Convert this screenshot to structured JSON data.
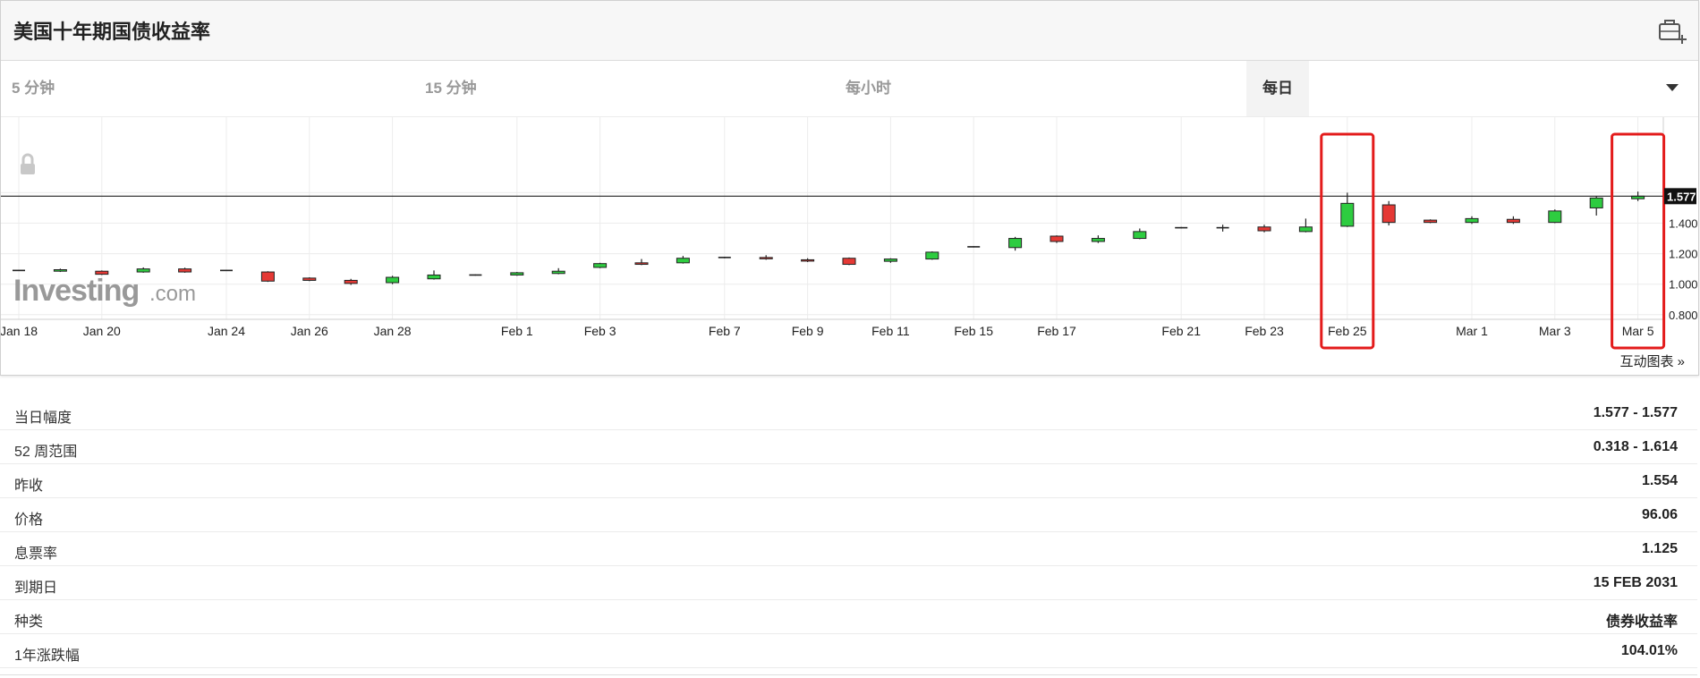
{
  "header": {
    "title": "美国十年期国债收益率",
    "portfolio_icon": "briefcase-plus-icon"
  },
  "tabs": [
    {
      "label": "5 分钟",
      "active": false
    },
    {
      "label": "15 分钟",
      "active": false
    },
    {
      "label": "每小时",
      "active": false
    },
    {
      "label": "每日",
      "active": true
    }
  ],
  "chart": {
    "interactive_link": "互动图表 »",
    "watermark": "Investing",
    "watermark_suffix": ".com"
  },
  "chart_data": {
    "type": "candlestick",
    "title": "",
    "y_ticks": [
      "1.400",
      "1.200",
      "1.000",
      "0.800"
    ],
    "ylim": [
      0.8,
      1.65
    ],
    "current_value": 1.577,
    "current_label": "1.577",
    "grid": true,
    "x_tick_labels": [
      {
        "i": 0,
        "label": "Jan 18"
      },
      {
        "i": 2,
        "label": "Jan 20"
      },
      {
        "i": 5,
        "label": "Jan 24"
      },
      {
        "i": 7,
        "label": "Jan 26"
      },
      {
        "i": 9,
        "label": "Jan 28"
      },
      {
        "i": 12,
        "label": "Feb 1"
      },
      {
        "i": 14,
        "label": "Feb 3"
      },
      {
        "i": 17,
        "label": "Feb 7"
      },
      {
        "i": 19,
        "label": "Feb 9"
      },
      {
        "i": 21,
        "label": "Feb 11"
      },
      {
        "i": 23,
        "label": "Feb 15"
      },
      {
        "i": 25,
        "label": "Feb 17"
      },
      {
        "i": 28,
        "label": "Feb 21"
      },
      {
        "i": 30,
        "label": "Feb 23"
      },
      {
        "i": 32,
        "label": "Feb 25"
      },
      {
        "i": 35,
        "label": "Mar 1"
      },
      {
        "i": 37,
        "label": "Mar 3"
      },
      {
        "i": 39,
        "label": "Mar 5"
      }
    ],
    "highlighted": [
      32,
      39
    ],
    "candles": [
      {
        "o": 1.09,
        "c": 1.09,
        "h": 1.094,
        "l": 1.086
      },
      {
        "o": 1.085,
        "c": 1.095,
        "h": 1.102,
        "l": 1.08
      },
      {
        "o": 1.085,
        "c": 1.065,
        "h": 1.09,
        "l": 1.06
      },
      {
        "o": 1.08,
        "c": 1.1,
        "h": 1.11,
        "l": 1.075
      },
      {
        "o": 1.1,
        "c": 1.08,
        "h": 1.108,
        "l": 1.075
      },
      {
        "o": 1.09,
        "c": 1.09,
        "h": 1.094,
        "l": 1.086
      },
      {
        "o": 1.08,
        "c": 1.02,
        "h": 1.085,
        "l": 1.015
      },
      {
        "o": 1.04,
        "c": 1.025,
        "h": 1.045,
        "l": 1.02
      },
      {
        "o": 1.025,
        "c": 1.005,
        "h": 1.035,
        "l": 0.995
      },
      {
        "o": 1.01,
        "c": 1.045,
        "h": 1.055,
        "l": 1.0
      },
      {
        "o": 1.035,
        "c": 1.06,
        "h": 1.09,
        "l": 1.03
      },
      {
        "o": 1.06,
        "c": 1.06,
        "h": 1.064,
        "l": 1.056
      },
      {
        "o": 1.06,
        "c": 1.075,
        "h": 1.08,
        "l": 1.055
      },
      {
        "o": 1.07,
        "c": 1.085,
        "h": 1.105,
        "l": 1.065
      },
      {
        "o": 1.11,
        "c": 1.135,
        "h": 1.14,
        "l": 1.105
      },
      {
        "o": 1.14,
        "c": 1.13,
        "h": 1.165,
        "l": 1.125
      },
      {
        "o": 1.14,
        "c": 1.17,
        "h": 1.185,
        "l": 1.135
      },
      {
        "o": 1.175,
        "c": 1.175,
        "h": 1.18,
        "l": 1.17
      },
      {
        "o": 1.175,
        "c": 1.17,
        "h": 1.19,
        "l": 1.16
      },
      {
        "o": 1.16,
        "c": 1.155,
        "h": 1.17,
        "l": 1.145
      },
      {
        "o": 1.17,
        "c": 1.13,
        "h": 1.175,
        "l": 1.125
      },
      {
        "o": 1.15,
        "c": 1.165,
        "h": 1.17,
        "l": 1.14
      },
      {
        "o": 1.165,
        "c": 1.21,
        "h": 1.215,
        "l": 1.16
      },
      {
        "o": 1.245,
        "c": 1.245,
        "h": 1.249,
        "l": 1.241
      },
      {
        "o": 1.24,
        "c": 1.3,
        "h": 1.31,
        "l": 1.22
      },
      {
        "o": 1.315,
        "c": 1.28,
        "h": 1.32,
        "l": 1.27
      },
      {
        "o": 1.28,
        "c": 1.3,
        "h": 1.32,
        "l": 1.27
      },
      {
        "o": 1.3,
        "c": 1.345,
        "h": 1.365,
        "l": 1.295
      },
      {
        "o": 1.37,
        "c": 1.37,
        "h": 1.375,
        "l": 1.365
      },
      {
        "o": 1.37,
        "c": 1.37,
        "h": 1.39,
        "l": 1.345
      },
      {
        "o": 1.375,
        "c": 1.35,
        "h": 1.39,
        "l": 1.34
      },
      {
        "o": 1.345,
        "c": 1.375,
        "h": 1.43,
        "l": 1.34
      },
      {
        "o": 1.38,
        "c": 1.53,
        "h": 1.6,
        "l": 1.375
      },
      {
        "o": 1.52,
        "c": 1.405,
        "h": 1.545,
        "l": 1.385
      },
      {
        "o": 1.42,
        "c": 1.405,
        "h": 1.425,
        "l": 1.4
      },
      {
        "o": 1.405,
        "c": 1.43,
        "h": 1.445,
        "l": 1.395
      },
      {
        "o": 1.425,
        "c": 1.405,
        "h": 1.445,
        "l": 1.395
      },
      {
        "o": 1.405,
        "c": 1.48,
        "h": 1.49,
        "l": 1.4
      },
      {
        "o": 1.5,
        "c": 1.565,
        "h": 1.575,
        "l": 1.45
      },
      {
        "o": 1.56,
        "c": 1.577,
        "h": 1.607,
        "l": 1.545
      }
    ]
  },
  "stats": [
    {
      "label": "当日幅度",
      "value": "1.577 - 1.577"
    },
    {
      "label": "52 周范围",
      "value": "0.318 - 1.614"
    },
    {
      "label": "昨收",
      "value": "1.554"
    },
    {
      "label": "价格",
      "value": "96.06"
    },
    {
      "label": "息票率",
      "value": "1.125"
    },
    {
      "label": "到期日",
      "value": "15 FEB 2031"
    },
    {
      "label": "种类",
      "value": "债券收益率"
    },
    {
      "label": "1年涨跌幅",
      "value": "104.01%"
    }
  ],
  "colors": {
    "up": "#2ecc40",
    "down": "#e53935",
    "highlight": "#e31b1b"
  }
}
